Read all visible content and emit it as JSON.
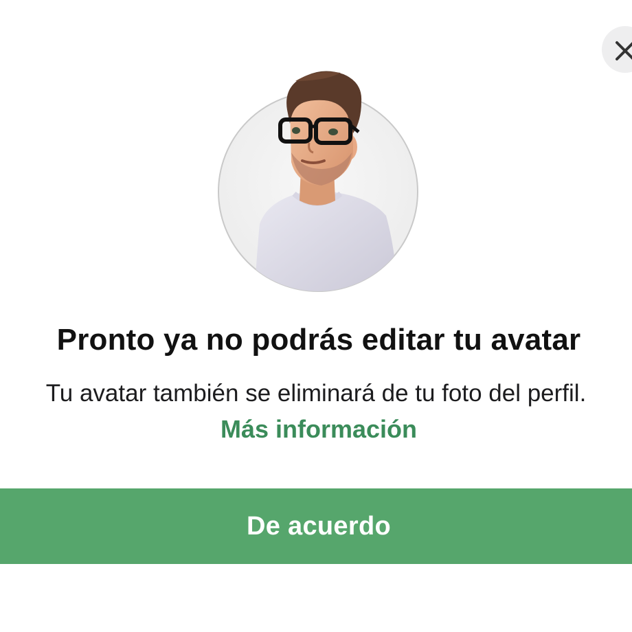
{
  "dialog": {
    "close_icon": "close-icon",
    "avatar_image": "3d-avatar-portrait",
    "title": "Pronto ya no podrás editar tu avatar",
    "subtitle": "Tu avatar también se eliminará de tu foto del perfil.",
    "more_info_link": "Más información",
    "confirm_button": "De acuerdo"
  },
  "colors": {
    "accent_green": "#56a66c",
    "link_green": "#3b8c5a",
    "close_bg": "#eeeeef"
  }
}
